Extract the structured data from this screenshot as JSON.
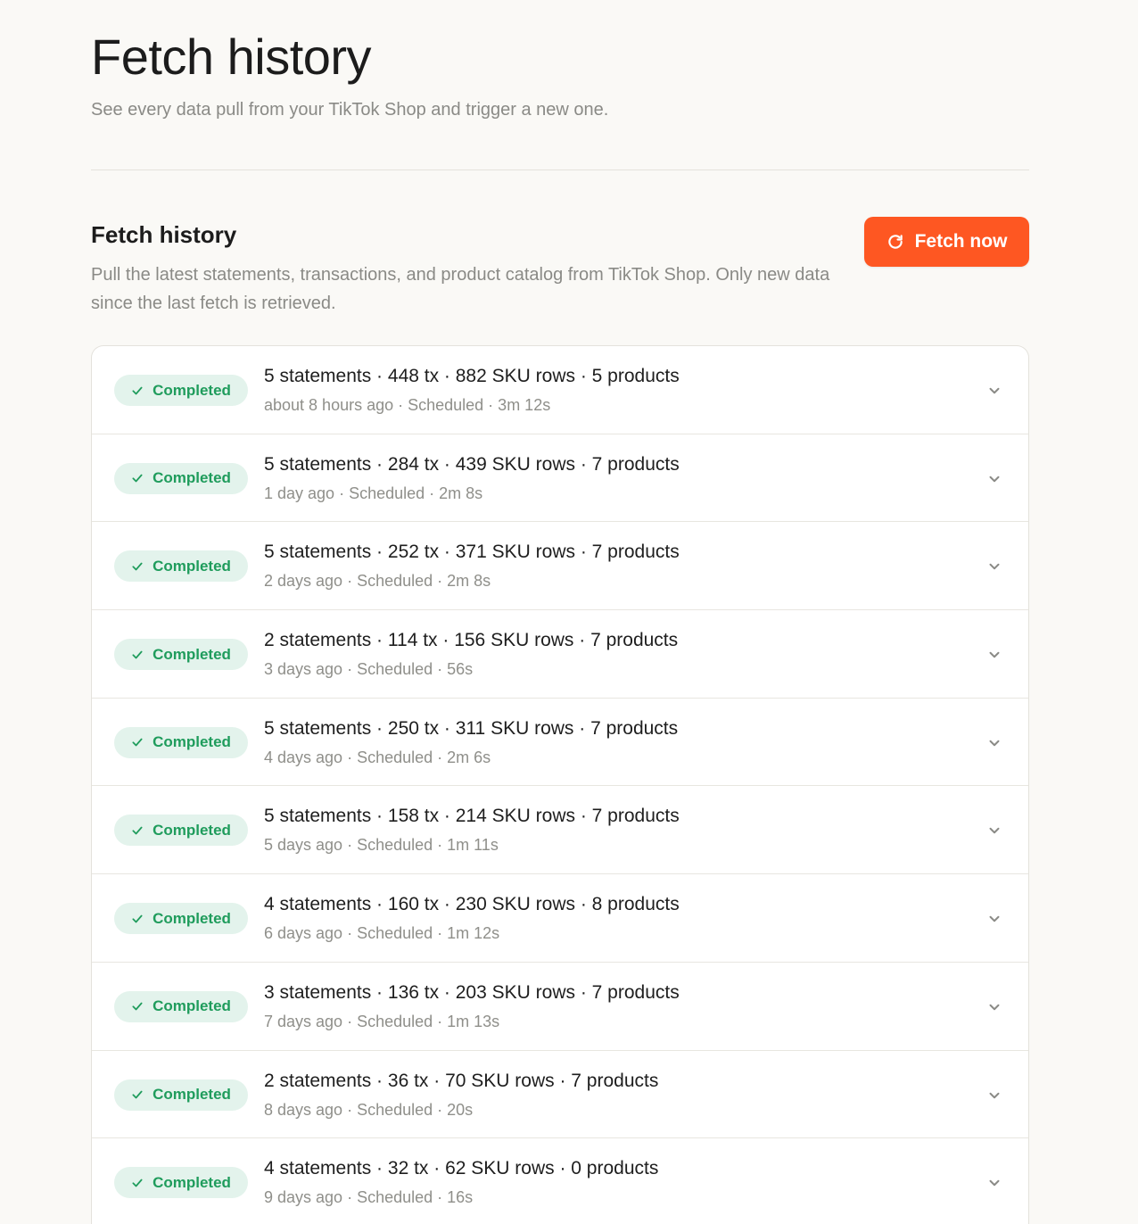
{
  "header": {
    "title": "Fetch history",
    "subtitle": "See every data pull from your TikTok Shop and trigger a new one."
  },
  "section": {
    "title": "Fetch history",
    "description": "Pull the latest statements, transactions, and product catalog from TikTok Shop. Only new data since the last fetch is retrieved.",
    "fetch_button_label": "Fetch now",
    "fetch_button_icon": "refresh-icon"
  },
  "colors": {
    "accent": "#fe5722",
    "success_text": "#1f9c5c",
    "success_bg": "#e3f3ec"
  },
  "fetches": [
    {
      "status": "Completed",
      "summary": "5 statements · 448 tx · 882 SKU rows · 5 products",
      "meta": "about 8 hours ago · Scheduled · 3m 12s"
    },
    {
      "status": "Completed",
      "summary": "5 statements · 284 tx · 439 SKU rows · 7 products",
      "meta": "1 day ago · Scheduled · 2m 8s"
    },
    {
      "status": "Completed",
      "summary": "5 statements · 252 tx · 371 SKU rows · 7 products",
      "meta": "2 days ago · Scheduled · 2m 8s"
    },
    {
      "status": "Completed",
      "summary": "2 statements · 114 tx · 156 SKU rows · 7 products",
      "meta": "3 days ago · Scheduled · 56s"
    },
    {
      "status": "Completed",
      "summary": "5 statements · 250 tx · 311 SKU rows · 7 products",
      "meta": "4 days ago · Scheduled · 2m 6s"
    },
    {
      "status": "Completed",
      "summary": "5 statements · 158 tx · 214 SKU rows · 7 products",
      "meta": "5 days ago · Scheduled · 1m 11s"
    },
    {
      "status": "Completed",
      "summary": "4 statements · 160 tx · 230 SKU rows · 8 products",
      "meta": "6 days ago · Scheduled · 1m 12s"
    },
    {
      "status": "Completed",
      "summary": "3 statements · 136 tx · 203 SKU rows · 7 products",
      "meta": "7 days ago · Scheduled · 1m 13s"
    },
    {
      "status": "Completed",
      "summary": "2 statements · 36 tx · 70 SKU rows · 7 products",
      "meta": "8 days ago · Scheduled · 20s"
    },
    {
      "status": "Completed",
      "summary": "4 statements · 32 tx · 62 SKU rows · 0 products",
      "meta": "9 days ago · Scheduled · 16s"
    }
  ]
}
